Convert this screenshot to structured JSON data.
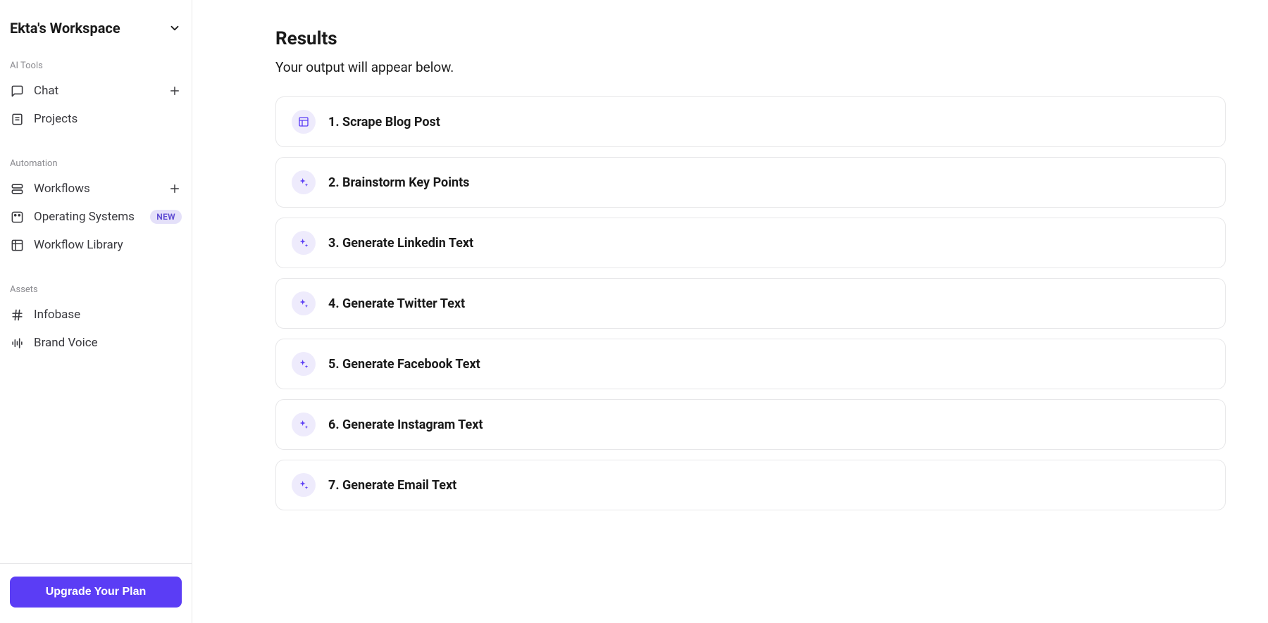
{
  "workspace": {
    "title": "Ekta's Workspace"
  },
  "sidebar": {
    "sections": {
      "ai_tools": {
        "label": "AI Tools",
        "items": [
          {
            "label": "Chat",
            "icon": "message-square-icon",
            "has_plus": true
          },
          {
            "label": "Projects",
            "icon": "file-text-icon",
            "has_plus": false
          }
        ]
      },
      "automation": {
        "label": "Automation",
        "items": [
          {
            "label": "Workflows",
            "icon": "workflow-icon",
            "has_plus": true
          },
          {
            "label": "Operating Systems",
            "icon": "shapes-icon",
            "badge": "NEW"
          },
          {
            "label": "Workflow Library",
            "icon": "library-icon"
          }
        ]
      },
      "assets": {
        "label": "Assets",
        "items": [
          {
            "label": "Infobase",
            "icon": "hash-icon"
          },
          {
            "label": "Brand Voice",
            "icon": "waveform-icon"
          }
        ]
      }
    },
    "upgrade_label": "Upgrade Your Plan"
  },
  "main": {
    "heading": "Results",
    "subheading": "Your output will appear below.",
    "steps": [
      {
        "label": "1. Scrape Blog Post",
        "icon": "layout-icon"
      },
      {
        "label": "2. Brainstorm Key Points",
        "icon": "sparkle-icon"
      },
      {
        "label": "3. Generate Linkedin Text",
        "icon": "sparkle-icon"
      },
      {
        "label": "4. Generate Twitter Text",
        "icon": "sparkle-icon"
      },
      {
        "label": "5. Generate Facebook Text",
        "icon": "sparkle-icon"
      },
      {
        "label": "6. Generate Instagram Text",
        "icon": "sparkle-icon"
      },
      {
        "label": "7. Generate Email Text",
        "icon": "sparkle-icon"
      }
    ]
  }
}
